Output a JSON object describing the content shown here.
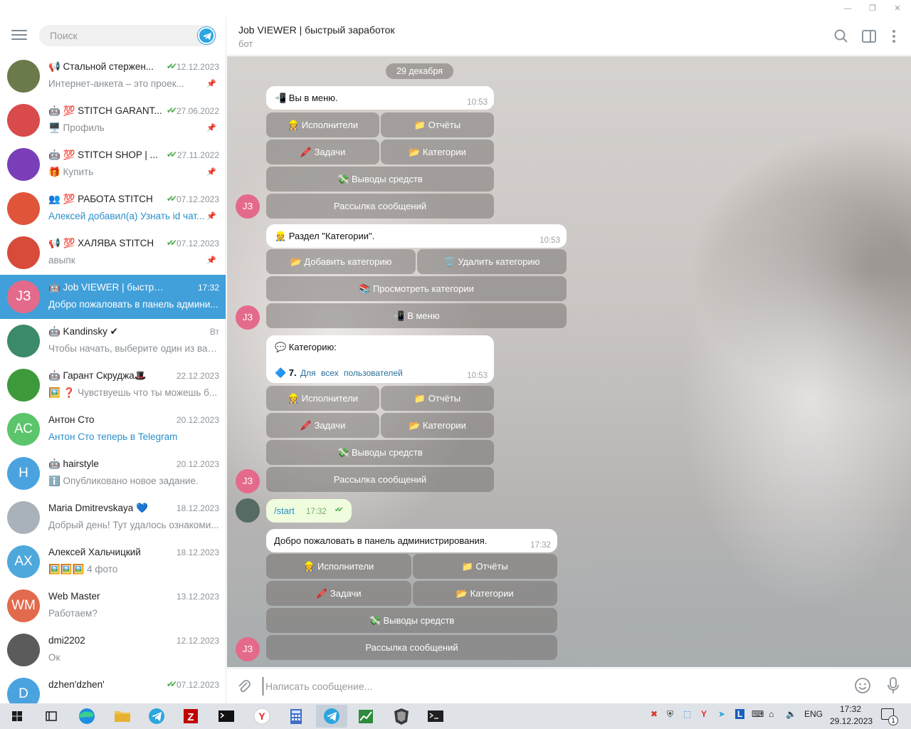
{
  "window": {
    "minimize": "—",
    "maximize": "❐",
    "close": "✕"
  },
  "sidebar": {
    "search_placeholder": "Поиск",
    "chats": [
      {
        "title": "📢 Стальной стержен...",
        "date": "12.12.2023",
        "preview": "Интернет-анкета – это проек...",
        "check": true,
        "pinned": true,
        "avatar_text": "",
        "avatar_color": "#6a7a4a",
        "active": false,
        "link": false
      },
      {
        "title": "🤖 💯 STITCH GARANT...",
        "date": "27.06.2022",
        "preview": "🖥️ Профиль",
        "check": true,
        "pinned": true,
        "avatar_text": "",
        "avatar_color": "#d94a4a",
        "active": false,
        "link": false
      },
      {
        "title": "🤖 💯 STITCH SHOP | ...",
        "date": "27.11.2022",
        "preview": "🎁 Купить",
        "check": true,
        "pinned": true,
        "avatar_text": "",
        "avatar_color": "#7a3fb8",
        "active": false,
        "link": false
      },
      {
        "title": "👥 💯 РАБОТА STITCH",
        "date": "07.12.2023",
        "preview": "Алексей добавил(а) Узнать id чат...",
        "check": true,
        "pinned": true,
        "avatar_text": "",
        "avatar_color": "#e0553a",
        "active": false,
        "link": true
      },
      {
        "title": "📢 💯 ХАЛЯВА STITCH",
        "date": "07.12.2023",
        "preview": "авыпк",
        "check": true,
        "pinned": true,
        "avatar_text": "",
        "avatar_color": "#d84b3b",
        "active": false,
        "link": false
      },
      {
        "title": "🤖 Job VIEWER | быстрый зар...",
        "date": "17:32",
        "preview": "Добро пожаловать в панель админи...",
        "check": false,
        "pinned": false,
        "avatar_text": "JЗ",
        "avatar_color": "#e46a8b",
        "active": true,
        "link": false
      },
      {
        "title": "🤖 Kandinsky ✔",
        "date": "Вт",
        "preview": "Чтобы начать, выберите один из вар...",
        "check": false,
        "pinned": false,
        "avatar_text": "",
        "avatar_color": "#3b8a6a",
        "active": false,
        "link": false
      },
      {
        "title": "🤖 Гарант Скруджа🎩",
        "date": "22.12.2023",
        "preview": "🖼️ ❓ Чувствуешь что ты можешь б...",
        "check": false,
        "pinned": false,
        "avatar_text": "",
        "avatar_color": "#3d9a3a",
        "active": false,
        "link": false
      },
      {
        "title": "Антон Сто",
        "date": "20.12.2023",
        "preview": "Антон Сто теперь в Telegram",
        "check": false,
        "pinned": false,
        "avatar_text": "АС",
        "avatar_color": "#5cc46a",
        "active": false,
        "link": true
      },
      {
        "title": "🤖 hairstyle",
        "date": "20.12.2023",
        "preview": "ℹ️ Опубликовано новое задание.",
        "check": false,
        "pinned": false,
        "avatar_text": "H",
        "avatar_color": "#4aa3df",
        "active": false,
        "link": false
      },
      {
        "title": "Maria Dmitrevskaya 💙",
        "date": "18.12.2023",
        "preview": "Добрый день! Тут удалось ознакоми...",
        "check": false,
        "pinned": false,
        "avatar_text": "",
        "avatar_color": "#a9b2ba",
        "active": false,
        "link": false
      },
      {
        "title": "Алексей Хальчицкий",
        "date": "18.12.2023",
        "preview": "🖼️🖼️🖼️ 4 фото",
        "check": false,
        "pinned": false,
        "avatar_text": "АХ",
        "avatar_color": "#4fa8dc",
        "active": false,
        "link": false
      },
      {
        "title": "Web Master",
        "date": "13.12.2023",
        "preview": "Работаем?",
        "check": false,
        "pinned": false,
        "avatar_text": "WM",
        "avatar_color": "#e26a4d",
        "active": false,
        "link": false
      },
      {
        "title": "dmi2202",
        "date": "12.12.2023",
        "preview": "Ок",
        "check": false,
        "pinned": false,
        "avatar_text": "",
        "avatar_color": "#5b5b5b",
        "active": false,
        "link": false
      },
      {
        "title": "dzhen'dzhen'",
        "date": "07.12.2023",
        "preview": "",
        "check": true,
        "pinned": false,
        "avatar_text": "D",
        "avatar_color": "#4aa3df",
        "active": false,
        "link": false
      }
    ]
  },
  "header": {
    "title": "Job VIEWER | быстрый заработок",
    "subtitle": "бот"
  },
  "messages": {
    "date": "29 декабря",
    "m1": {
      "text": "📲 Вы в меню.",
      "time": "10:53"
    },
    "kb1": [
      "👷 Исполнители",
      "📁 Отчёты",
      "🖍️ Задачи",
      "📂 Категории",
      "💸 Выводы средств",
      "Рассылка сообщений"
    ],
    "m2": {
      "text": "👷 Раздел \"Категории\".",
      "time": "10:53"
    },
    "kb2": [
      "📂 Добавить категорию",
      "🗑️ Удалить категорию",
      "📚 Просмотреть категории",
      "📲 В меню"
    ],
    "m3": {
      "title": "💬 Категорию:",
      "num": "🔷 7.",
      "line": "Для  всех  пользователей",
      "time": "10:53"
    },
    "kb3": [
      "👷 Исполнители",
      "📁 Отчёты",
      "🖍️ Задачи",
      "📂 Категории",
      "💸 Выводы средств",
      "Рассылка сообщений"
    ],
    "out": {
      "text": "/start",
      "time": "17:32",
      "check": "✔✔"
    },
    "m4": {
      "text": "Добро пожаловать в панель администрирования.",
      "time": "17:32"
    },
    "kb4": [
      "👷 Исполнители",
      "📁 Отчёты",
      "🖍️ Задачи",
      "📂 Категории",
      "💸 Выводы средств",
      "Рассылка сообщений"
    ],
    "bot_avatar": "JЗ"
  },
  "input": {
    "placeholder": "Написать сообщение..."
  },
  "taskbar": {
    "lang": "ENG",
    "time": "17:32",
    "date": "29.12.2023",
    "notif": "1"
  }
}
